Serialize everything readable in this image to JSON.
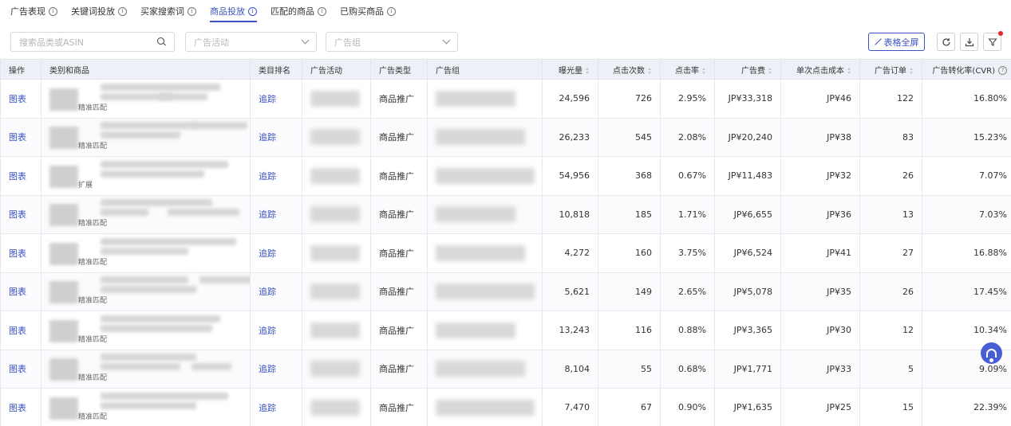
{
  "tabs": [
    {
      "label": "广告表现",
      "active": false
    },
    {
      "label": "关键词投放",
      "active": false
    },
    {
      "label": "买家搜索词",
      "active": false
    },
    {
      "label": "商品投放",
      "active": true
    },
    {
      "label": "匹配的商品",
      "active": false
    },
    {
      "label": "已购买商品",
      "active": false
    }
  ],
  "filters": {
    "search_placeholder": "搜索品类或ASIN",
    "campaign_placeholder": "广告活动",
    "adgroup_placeholder": "广告组"
  },
  "toolbar": {
    "fullscreen_label": "表格全屏"
  },
  "table": {
    "headers": [
      "操作",
      "类别和商品",
      "类目排名",
      "广告活动",
      "广告类型",
      "广告组",
      "曝光量",
      "点击次数",
      "点击率",
      "广告费",
      "单次点击成本",
      "广告订单",
      "广告转化率(CVR)"
    ],
    "rows": [
      {
        "action": "图表",
        "match": "精准匹配",
        "rank": "追踪",
        "type": "商品推广",
        "impressions": "24,596",
        "clicks": "726",
        "ctr": "2.95%",
        "spend": "JP¥33,318",
        "cpc": "JP¥46",
        "orders": "122",
        "cvr": "16.80%"
      },
      {
        "action": "图表",
        "match": "精准匹配",
        "rank": "追踪",
        "type": "商品推广",
        "impressions": "26,233",
        "clicks": "545",
        "ctr": "2.08%",
        "spend": "JP¥20,240",
        "cpc": "JP¥38",
        "orders": "83",
        "cvr": "15.23%"
      },
      {
        "action": "图表",
        "match": "扩展",
        "rank": "追踪",
        "type": "商品推广",
        "impressions": "54,956",
        "clicks": "368",
        "ctr": "0.67%",
        "spend": "JP¥11,483",
        "cpc": "JP¥32",
        "orders": "26",
        "cvr": "7.07%"
      },
      {
        "action": "图表",
        "match": "精准匹配",
        "rank": "追踪",
        "type": "商品推广",
        "impressions": "10,818",
        "clicks": "185",
        "ctr": "1.71%",
        "spend": "JP¥6,655",
        "cpc": "JP¥36",
        "orders": "13",
        "cvr": "7.03%"
      },
      {
        "action": "图表",
        "match": "精准匹配",
        "rank": "追踪",
        "type": "商品推广",
        "impressions": "4,272",
        "clicks": "160",
        "ctr": "3.75%",
        "spend": "JP¥6,524",
        "cpc": "JP¥41",
        "orders": "27",
        "cvr": "16.88%"
      },
      {
        "action": "图表",
        "match": "精准匹配",
        "rank": "追踪",
        "type": "商品推广",
        "impressions": "5,621",
        "clicks": "149",
        "ctr": "2.65%",
        "spend": "JP¥5,078",
        "cpc": "JP¥35",
        "orders": "26",
        "cvr": "17.45%"
      },
      {
        "action": "图表",
        "match": "精准匹配",
        "rank": "追踪",
        "type": "商品推广",
        "impressions": "13,243",
        "clicks": "116",
        "ctr": "0.88%",
        "spend": "JP¥3,365",
        "cpc": "JP¥30",
        "orders": "12",
        "cvr": "10.34%"
      },
      {
        "action": "图表",
        "match": "精准匹配",
        "rank": "追踪",
        "type": "商品推广",
        "impressions": "8,104",
        "clicks": "55",
        "ctr": "0.68%",
        "spend": "JP¥1,771",
        "cpc": "JP¥33",
        "orders": "5",
        "cvr": "9.09%"
      },
      {
        "action": "图表",
        "match": "精准匹配",
        "rank": "追踪",
        "type": "商品推广",
        "impressions": "7,470",
        "clicks": "67",
        "ctr": "0.90%",
        "spend": "JP¥1,635",
        "cpc": "JP¥25",
        "orders": "15",
        "cvr": "22.39%"
      }
    ]
  },
  "colors": {
    "accent": "#3a52c4",
    "header_bg": "#eef0f7",
    "dot": "#e6262c"
  },
  "icons": [
    "info-icon",
    "search-icon",
    "chevron-down-icon",
    "expand-icon",
    "refresh-icon",
    "download-icon",
    "filter-icon",
    "sort-icon",
    "support-icon"
  ]
}
